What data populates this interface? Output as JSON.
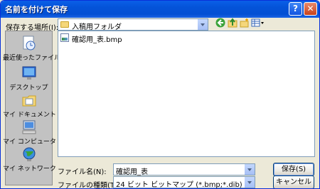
{
  "window": {
    "title": "名前を付けて保存",
    "help_label": "?",
    "close_label": "✕"
  },
  "location": {
    "label": "保存する場所(I):",
    "value": "入稿用フォルダ"
  },
  "toolbar": {
    "icons": [
      "back-icon",
      "up-folder-icon",
      "new-folder-icon",
      "view-menu-icon"
    ]
  },
  "places": [
    {
      "label": "最近使ったファイル",
      "icon": "recent-files-icon"
    },
    {
      "label": "デスクトップ",
      "icon": "desktop-icon"
    },
    {
      "label": "マイ ドキュメント",
      "icon": "my-documents-icon"
    },
    {
      "label": "マイ コンピュータ",
      "icon": "my-computer-icon"
    },
    {
      "label": "マイ ネットワーク",
      "icon": "my-network-icon"
    }
  ],
  "files": [
    {
      "name": "確認用_表.bmp",
      "icon": "bitmap-file-icon"
    }
  ],
  "filename": {
    "label": "ファイル名(N):",
    "value": "確認用_表"
  },
  "filetype": {
    "label": "ファイルの種類(T):",
    "value": "24 ビット ビットマップ (*.bmp;*.dib)"
  },
  "buttons": {
    "save": "保存(S)",
    "cancel": "キャンセル"
  }
}
